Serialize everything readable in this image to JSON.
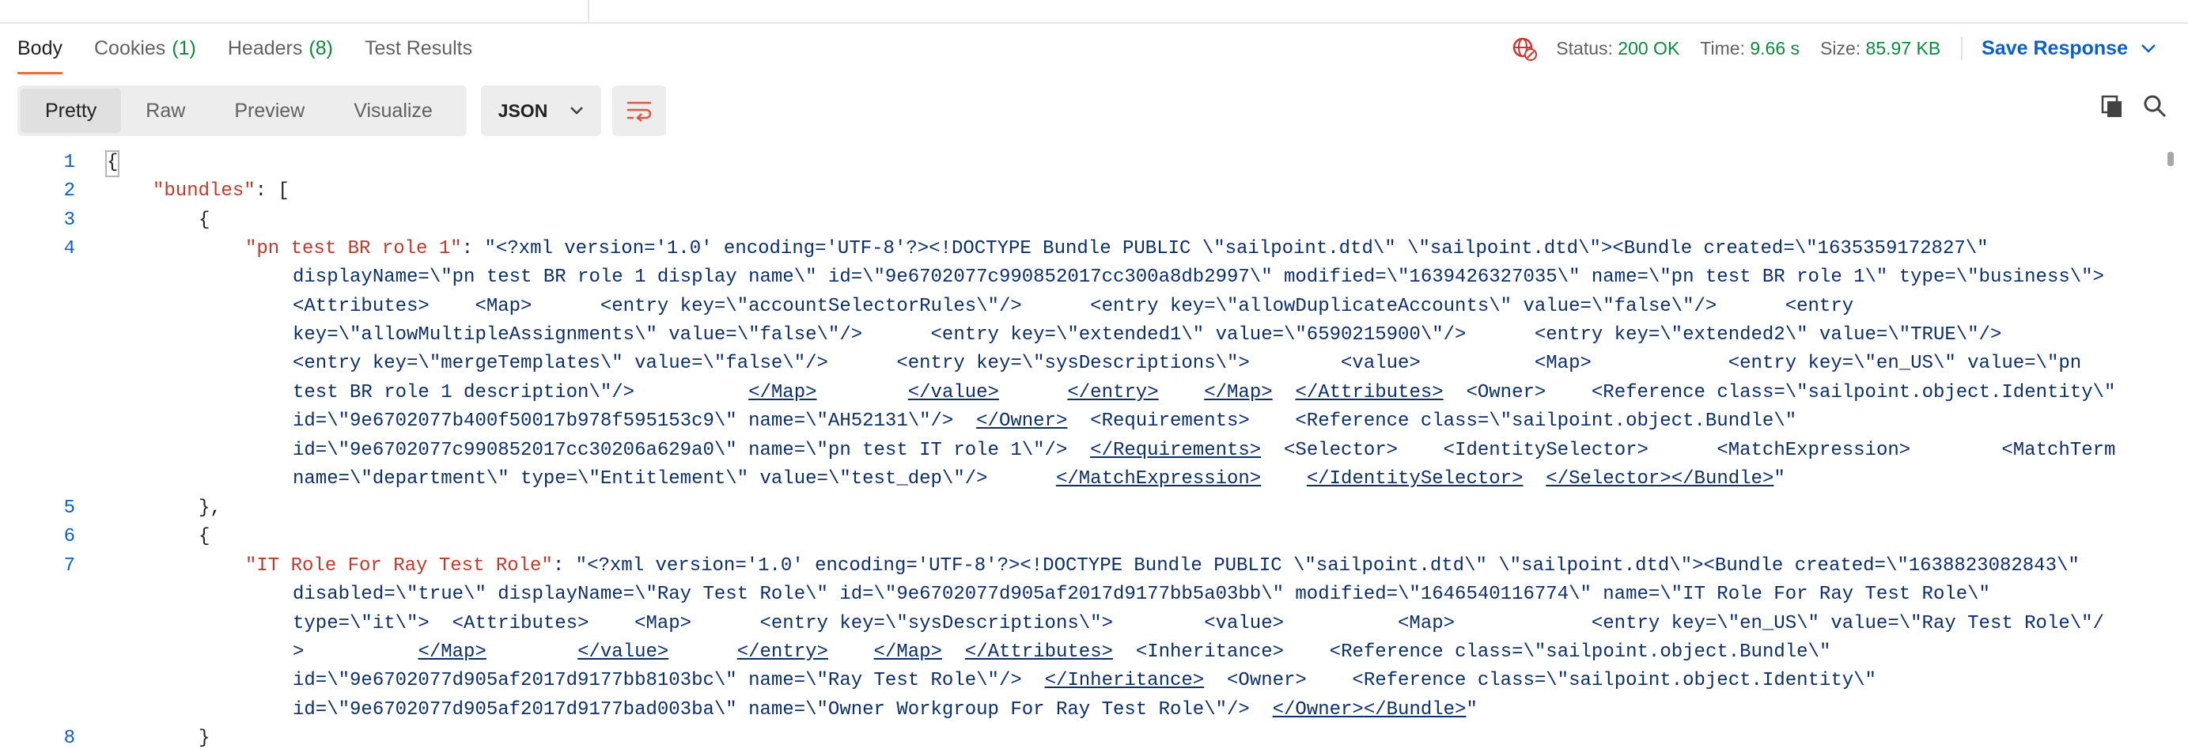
{
  "tabs": [
    {
      "label": "Body",
      "count": ""
    },
    {
      "label": "Cookies",
      "count": "(1)"
    },
    {
      "label": "Headers",
      "count": "(8)"
    },
    {
      "label": "Test Results",
      "count": ""
    }
  ],
  "status": {
    "status_label": "Status:",
    "status_value": "200 OK",
    "time_label": "Time:",
    "time_value": "9.66 s",
    "size_label": "Size:",
    "size_value": "85.97 KB",
    "save_label": "Save Response"
  },
  "view_modes": [
    "Pretty",
    "Raw",
    "Preview",
    "Visualize"
  ],
  "format": "JSON",
  "icons": {
    "globe": "globe-error-icon",
    "wrap": "wrap-lines-icon",
    "copy": "copy-icon",
    "search": "search-icon"
  },
  "colors": {
    "accent": "#f26b3a",
    "success": "#0a8a3b",
    "link": "#0b5fc9",
    "key": "#c0392b"
  },
  "code": {
    "line_numbers": [
      "1",
      "2",
      "3",
      "4",
      "5",
      "6",
      "7",
      "8"
    ],
    "l1": "{",
    "l2_key": "\"bundles\"",
    "l2_rest": ": [",
    "l3": "{",
    "l4_key": "\"pn test BR role 1\"",
    "l4_a": ": \"<?xml version='1.0' encoding='UTF-8'?><!DOCTYPE Bundle PUBLIC \\\"sailpoint.dtd\\\" \\\"sailpoint.dtd\\\"><Bundle created=\\\"1635359172827\\\"",
    "l4_b": "displayName=\\\"pn test BR role 1 display name\\\" id=\\\"9e6702077c990852017cc300a8db2997\\\" modified=\\\"1639426327035\\\" name=\\\"pn test BR role 1\\\" type=\\\"business\\\">",
    "l4_c": "<Attributes>    <Map>      <entry key=\\\"accountSelectorRules\\\"/>      <entry key=\\\"allowDuplicateAccounts\\\" value=\\\"false\\\"/>      <entry",
    "l4_d": "key=\\\"allowMultipleAssignments\\\" value=\\\"false\\\"/>      <entry key=\\\"extended1\\\" value=\\\"6590215900\\\"/>      <entry key=\\\"extended2\\\" value=\\\"TRUE\\\"/>",
    "l4_e": "<entry key=\\\"mergeTemplates\\\" value=\\\"false\\\"/>      <entry key=\\\"sysDescriptions\\\">        <value>          <Map>            <entry key=\\\"en_US\\\" value=\\\"pn",
    "l4_f1": "test BR role 1 description\\\"/>          ",
    "l4_f_u1": "</Map>",
    "l4_f2": "        ",
    "l4_f_u2": "</value>",
    "l4_f3": "      ",
    "l4_f_u3": "</entry>",
    "l4_f4": "    ",
    "l4_f_u4": "</Map>",
    "l4_f5": "  ",
    "l4_f_u5": "</Attributes>",
    "l4_f6": "  <Owner>    <Reference class=\\\"sailpoint.object.Identity\\\"",
    "l4_g1": "id=\\\"9e6702077b400f50017b978f595153c9\\\" name=\\\"AH52131\\\"/>  ",
    "l4_g_u1": "</Owner>",
    "l4_g2": "  <Requirements>    <Reference class=\\\"sailpoint.object.Bundle\\\"",
    "l4_h1": "id=\\\"9e6702077c990852017cc30206a629a0\\\" name=\\\"pn test IT role 1\\\"/>  ",
    "l4_h_u1": "</Requirements>",
    "l4_h2": "  <Selector>    <IdentitySelector>      <MatchExpression>        <MatchTerm",
    "l4_i1": "name=\\\"department\\\" type=\\\"Entitlement\\\" value=\\\"test_dep\\\"/>      ",
    "l4_i_u1": "</MatchExpression>",
    "l4_i2": "    ",
    "l4_i_u2": "</IdentitySelector>",
    "l4_i3": "  ",
    "l4_i_u3": "</Selector>",
    "l4_i_u4": "</Bundle>",
    "l4_i4": "\"",
    "l5": "},",
    "l6": "{",
    "l7_key": "\"IT Role For Ray Test Role\"",
    "l7_a": ": \"<?xml version='1.0' encoding='UTF-8'?><!DOCTYPE Bundle PUBLIC \\\"sailpoint.dtd\\\" \\\"sailpoint.dtd\\\"><Bundle created=\\\"1638823082843\\\"",
    "l7_b": "disabled=\\\"true\\\" displayName=\\\"Ray Test Role\\\" id=\\\"9e6702077d905af2017d9177bb5a03bb\\\" modified=\\\"1646540116774\\\" name=\\\"IT Role For Ray Test Role\\\"",
    "l7_c": "type=\\\"it\\\">  <Attributes>    <Map>      <entry key=\\\"sysDescriptions\\\">        <value>          <Map>            <entry key=\\\"en_US\\\" value=\\\"Ray Test Role\\\"/",
    "l7_d1": ">          ",
    "l7_d_u1": "</Map>",
    "l7_d2": "        ",
    "l7_d_u2": "</value>",
    "l7_d3": "      ",
    "l7_d_u3": "</entry>",
    "l7_d4": "    ",
    "l7_d_u4": "</Map>",
    "l7_d5": "  ",
    "l7_d_u5": "</Attributes>",
    "l7_d6": "  <Inheritance>    <Reference class=\\\"sailpoint.object.Bundle\\\"",
    "l7_e1": "id=\\\"9e6702077d905af2017d9177bb8103bc\\\" name=\\\"Ray Test Role\\\"/>  ",
    "l7_e_u1": "</Inheritance>",
    "l7_e2": "  <Owner>    <Reference class=\\\"sailpoint.object.Identity\\\"",
    "l7_f1": "id=\\\"9e6702077d905af2017d9177bad003ba\\\" name=\\\"Owner Workgroup For Ray Test Role\\\"/>  ",
    "l7_f_u1": "</Owner>",
    "l7_f_u2": "</Bundle>",
    "l7_f2": "\"",
    "l8": "}"
  }
}
